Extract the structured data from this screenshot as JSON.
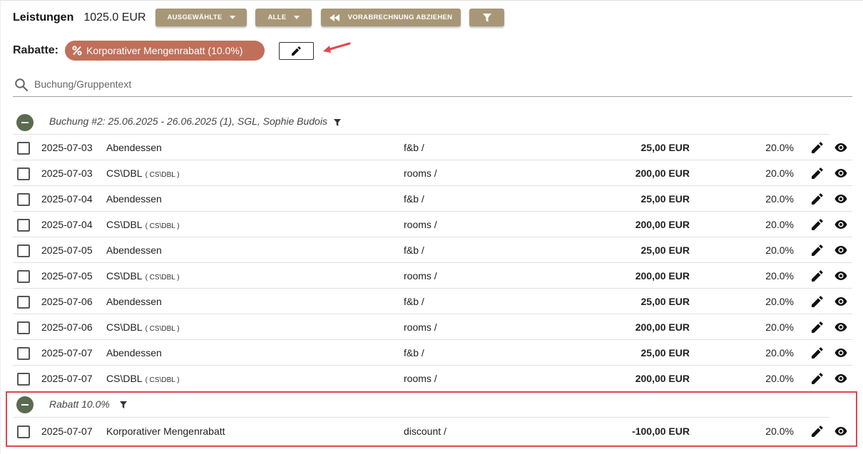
{
  "header": {
    "title": "Leistungen",
    "total": "1025.0 EUR",
    "buttons": {
      "selected": "AUSGEWÄHLTE",
      "all": "ALLE",
      "prepayment": "VORABRECHNUNG ABZIEHEN"
    }
  },
  "discounts": {
    "label": "Rabatte:",
    "chip": "Korporativer Mengenrabatt (10.0%)"
  },
  "search": {
    "placeholder": "Buchung/Gruppentext"
  },
  "groups": [
    {
      "title": "Buchung #2: 25.06.2025 - 26.06.2025 (1), SGL, Sophie Budois",
      "rows": [
        {
          "date": "2025-07-03",
          "name": "Abendessen",
          "code": "",
          "category": "f&b /",
          "amount": "25,00 EUR",
          "vat": "20.0%"
        },
        {
          "date": "2025-07-03",
          "name": "CS\\DBL",
          "code": "( CS\\DBL )",
          "category": "rooms /",
          "amount": "200,00 EUR",
          "vat": "20.0%"
        },
        {
          "date": "2025-07-04",
          "name": "Abendessen",
          "code": "",
          "category": "f&b /",
          "amount": "25,00 EUR",
          "vat": "20.0%"
        },
        {
          "date": "2025-07-04",
          "name": "CS\\DBL",
          "code": "( CS\\DBL )",
          "category": "rooms /",
          "amount": "200,00 EUR",
          "vat": "20.0%"
        },
        {
          "date": "2025-07-05",
          "name": "Abendessen",
          "code": "",
          "category": "f&b /",
          "amount": "25,00 EUR",
          "vat": "20.0%"
        },
        {
          "date": "2025-07-05",
          "name": "CS\\DBL",
          "code": "( CS\\DBL )",
          "category": "rooms /",
          "amount": "200,00 EUR",
          "vat": "20.0%"
        },
        {
          "date": "2025-07-06",
          "name": "Abendessen",
          "code": "",
          "category": "f&b /",
          "amount": "25,00 EUR",
          "vat": "20.0%"
        },
        {
          "date": "2025-07-06",
          "name": "CS\\DBL",
          "code": "( CS\\DBL )",
          "category": "rooms /",
          "amount": "200,00 EUR",
          "vat": "20.0%"
        },
        {
          "date": "2025-07-07",
          "name": "Abendessen",
          "code": "",
          "category": "f&b /",
          "amount": "25,00 EUR",
          "vat": "20.0%"
        },
        {
          "date": "2025-07-07",
          "name": "CS\\DBL",
          "code": "( CS\\DBL )",
          "category": "rooms /",
          "amount": "200,00 EUR",
          "vat": "20.0%"
        }
      ]
    },
    {
      "title": "Rabatt 10.0%",
      "rows": [
        {
          "date": "2025-07-07",
          "name": "Korporativer Mengenrabatt",
          "code": "",
          "category": "discount /",
          "amount": "-100,00 EUR",
          "vat": "20.0%"
        }
      ]
    }
  ],
  "colors": {
    "button": "#a89777",
    "chip": "#c0705a",
    "collapse": "#5b6b4f",
    "annotation": "#e0474c"
  },
  "icons": [
    "search-icon",
    "filter-icon",
    "rewind-icon",
    "percent-icon",
    "pencil-icon",
    "eye-icon",
    "minus-icon",
    "chevron-down-icon"
  ]
}
